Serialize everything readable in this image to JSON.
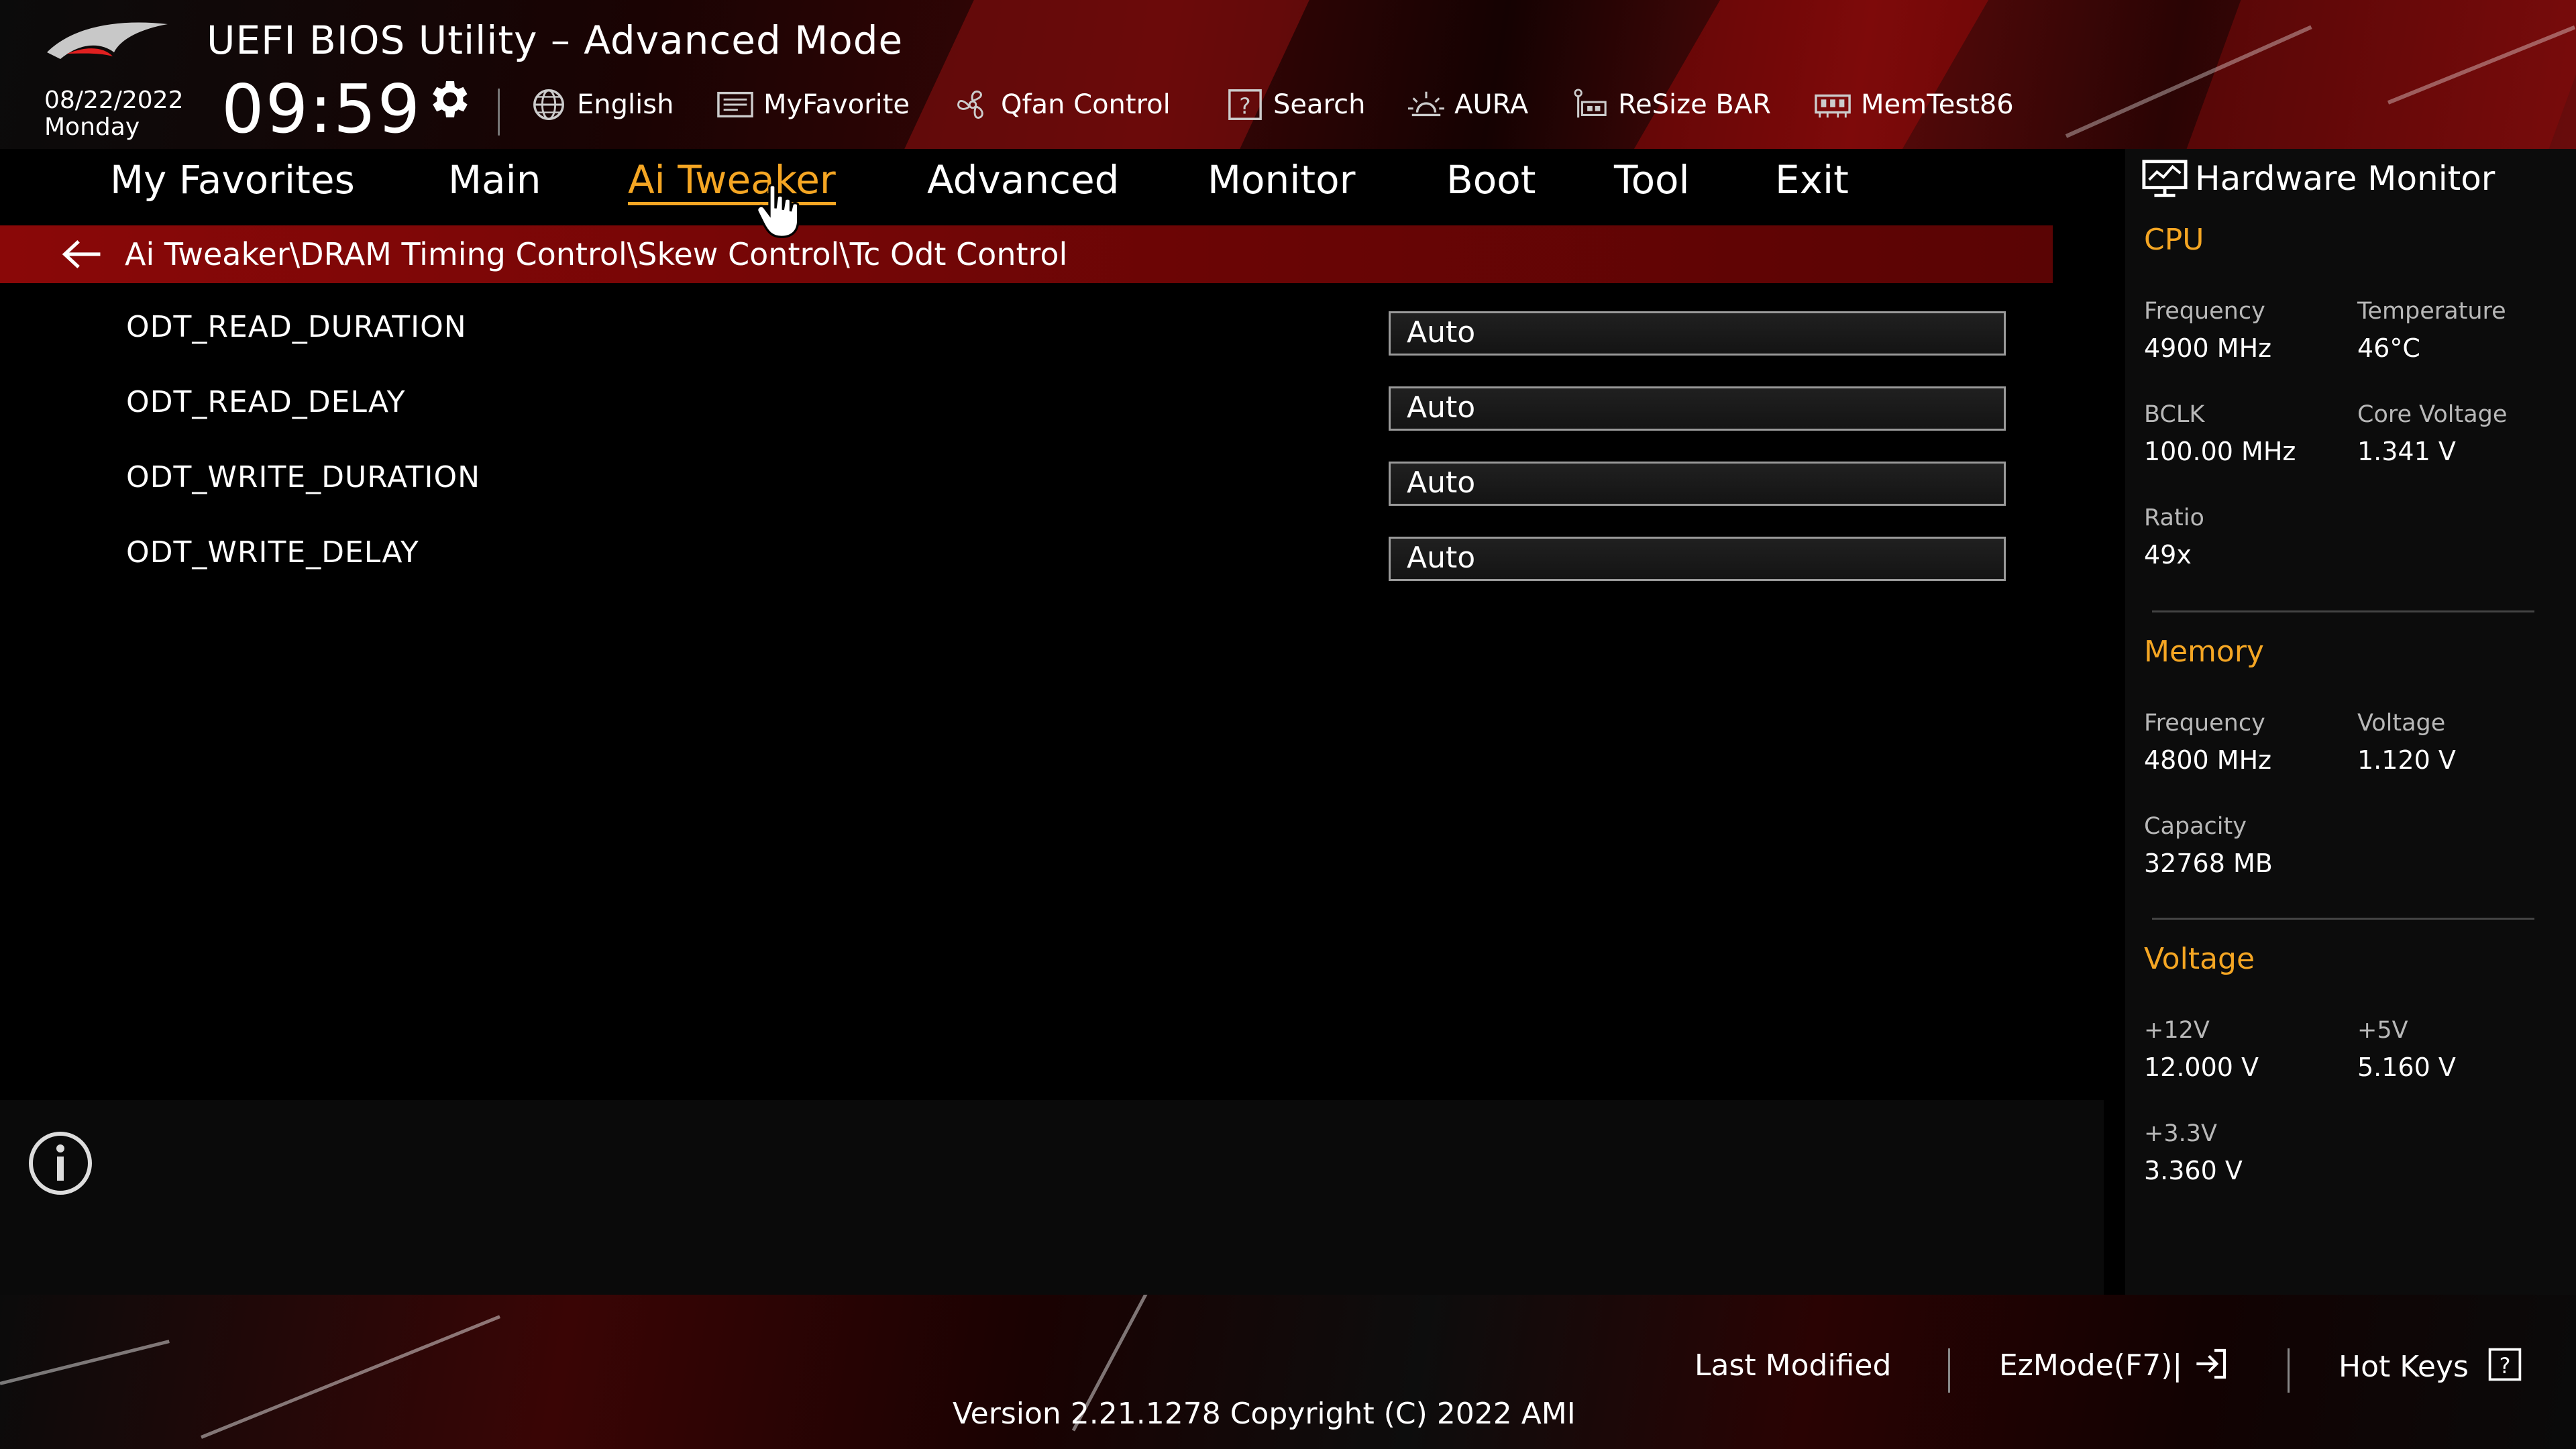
{
  "header": {
    "title": "UEFI BIOS Utility – Advanced Mode",
    "date": "08/22/2022",
    "day": "Monday",
    "time": "09:59"
  },
  "toolbar": {
    "items": [
      {
        "label": "English",
        "icon": "globe-icon"
      },
      {
        "label": "MyFavorite",
        "icon": "favorite-icon"
      },
      {
        "label": "Qfan Control",
        "icon": "fan-icon"
      },
      {
        "label": "Search",
        "icon": "search-help-icon"
      },
      {
        "label": "AURA",
        "icon": "aura-icon"
      },
      {
        "label": "ReSize BAR",
        "icon": "resize-bar-icon"
      },
      {
        "label": "MemTest86",
        "icon": "memtest-icon"
      }
    ]
  },
  "nav": {
    "tabs": [
      {
        "label": "My Favorites"
      },
      {
        "label": "Main"
      },
      {
        "label": "Ai Tweaker",
        "active": true
      },
      {
        "label": "Advanced"
      },
      {
        "label": "Monitor"
      },
      {
        "label": "Boot"
      },
      {
        "label": "Tool"
      },
      {
        "label": "Exit"
      }
    ]
  },
  "main": {
    "breadcrumb": "Ai Tweaker\\DRAM Timing Control\\Skew Control\\Tc Odt Control",
    "settings": [
      {
        "name": "ODT_READ_DURATION",
        "value": "Auto"
      },
      {
        "name": "ODT_READ_DELAY",
        "value": "Auto"
      },
      {
        "name": "ODT_WRITE_DURATION",
        "value": "Auto"
      },
      {
        "name": "ODT_WRITE_DELAY",
        "value": "Auto"
      }
    ]
  },
  "hw": {
    "title": "Hardware Monitor",
    "cpu": {
      "heading": "CPU",
      "frequency_label": "Frequency",
      "frequency": "4900 MHz",
      "temperature_label": "Temperature",
      "temperature": "46°C",
      "bclk_label": "BCLK",
      "bclk": "100.00 MHz",
      "core_voltage_label": "Core Voltage",
      "core_voltage": "1.341 V",
      "ratio_label": "Ratio",
      "ratio": "49x"
    },
    "memory": {
      "heading": "Memory",
      "frequency_label": "Frequency",
      "frequency": "4800 MHz",
      "voltage_label": "Voltage",
      "voltage": "1.120 V",
      "capacity_label": "Capacity",
      "capacity": "32768 MB"
    },
    "voltage": {
      "heading": "Voltage",
      "v12_label": "+12V",
      "v12": "12.000 V",
      "v5_label": "+5V",
      "v5": "5.160 V",
      "v33_label": "+3.3V",
      "v33": "3.360 V"
    }
  },
  "footer": {
    "last_modified": "Last Modified",
    "ezmode": "EzMode(F7)|",
    "hotkeys": "Hot Keys",
    "version": "Version 2.21.1278 Copyright (C) 2022 AMI"
  },
  "colors": {
    "accent": "#f5a623",
    "breadcrumb_bg": "#8a0808",
    "background": "#000000"
  }
}
